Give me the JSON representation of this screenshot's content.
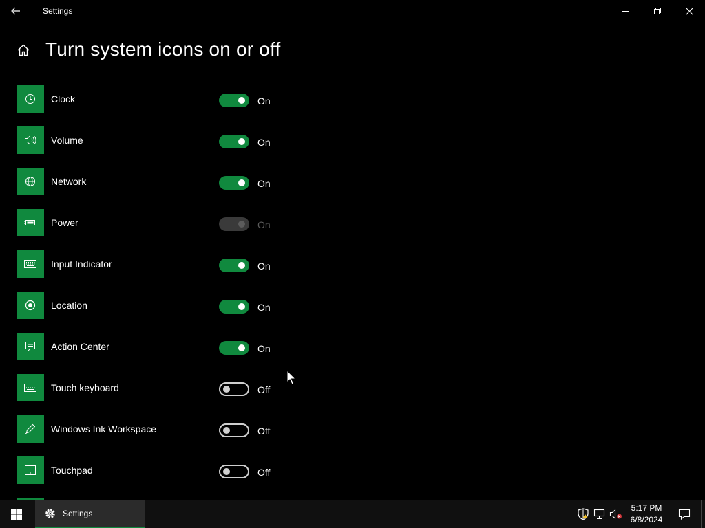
{
  "window": {
    "title": "Settings"
  },
  "page": {
    "title": "Turn system icons on or off"
  },
  "settings": [
    {
      "label": "Clock",
      "icon": "clock-icon",
      "state": "on",
      "enabled": true,
      "state_label": "On"
    },
    {
      "label": "Volume",
      "icon": "volume-icon",
      "state": "on",
      "enabled": true,
      "state_label": "On"
    },
    {
      "label": "Network",
      "icon": "globe-icon",
      "state": "on",
      "enabled": true,
      "state_label": "On"
    },
    {
      "label": "Power",
      "icon": "battery-icon",
      "state": "on",
      "enabled": false,
      "state_label": "On"
    },
    {
      "label": "Input Indicator",
      "icon": "keyboard-icon",
      "state": "on",
      "enabled": true,
      "state_label": "On"
    },
    {
      "label": "Location",
      "icon": "location-icon",
      "state": "on",
      "enabled": true,
      "state_label": "On"
    },
    {
      "label": "Action Center",
      "icon": "action-center-icon",
      "state": "on",
      "enabled": true,
      "state_label": "On"
    },
    {
      "label": "Touch keyboard",
      "icon": "keyboard-icon",
      "state": "off",
      "enabled": true,
      "state_label": "Off"
    },
    {
      "label": "Windows Ink Workspace",
      "icon": "pen-icon",
      "state": "off",
      "enabled": true,
      "state_label": "Off"
    },
    {
      "label": "Touchpad",
      "icon": "touchpad-icon",
      "state": "off",
      "enabled": true,
      "state_label": "Off"
    }
  ],
  "taskbar": {
    "app_label": "Settings",
    "time": "5:17 PM",
    "date": "6/8/2024"
  },
  "colors": {
    "accent": "#10893e",
    "background": "#000000",
    "taskbar": "#101010"
  }
}
